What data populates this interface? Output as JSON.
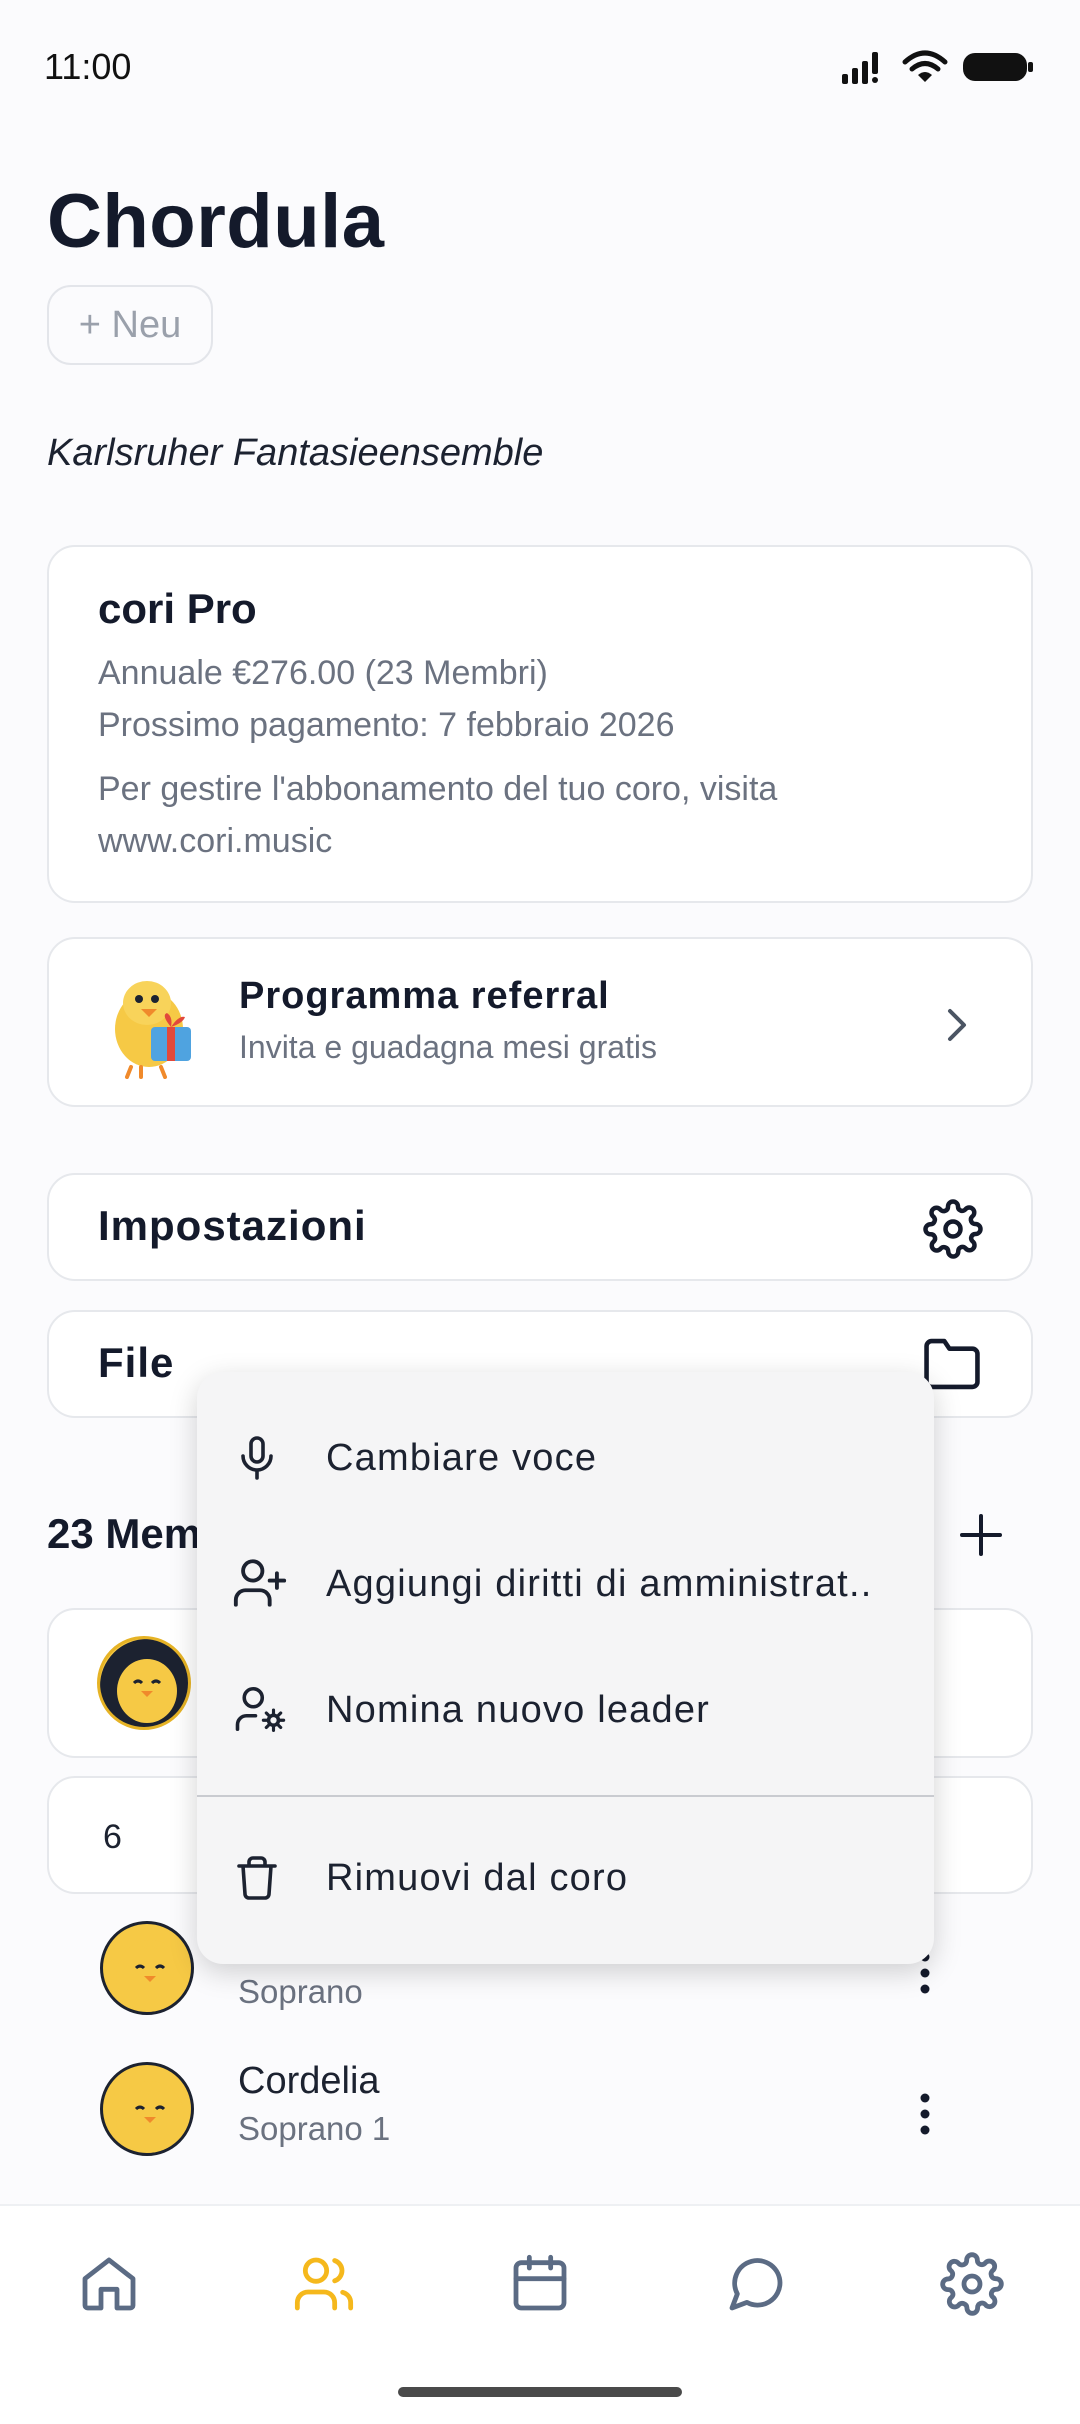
{
  "status_bar": {
    "time": "11:00"
  },
  "header": {
    "title": "Chordula",
    "new_button_label": "+ Neu"
  },
  "choir": {
    "name": "Karlsruher Fantasieensemble"
  },
  "subscription": {
    "plan": "cori Pro",
    "billing": "Annuale €276.00 (23 Membri)",
    "next_payment": "Prossimo pagamento: 7 febbraio 2026",
    "manage_line1": "Per gestire l'abbonamento del tuo coro, visita",
    "manage_line2": "www.cori.music"
  },
  "referral": {
    "title": "Programma referral",
    "subtitle": "Invita e guadagna mesi gratis"
  },
  "settings_row": {
    "label": "Impostazioni",
    "icon": "gear-icon"
  },
  "files_row": {
    "label": "File",
    "icon": "folder-icon"
  },
  "members": {
    "heading": "23 Mem",
    "group_count": "6",
    "items": [
      {
        "name": "",
        "voice": "Soprano"
      },
      {
        "name": "Cordelia",
        "voice": "Soprano 1"
      }
    ]
  },
  "context_menu": {
    "items": [
      {
        "label": "Cambiare voce",
        "icon": "microphone-icon"
      },
      {
        "label": "Aggiungi diritti di amministrat..",
        "icon": "user-plus-icon"
      },
      {
        "label": "Nomina nuovo leader",
        "icon": "user-cog-icon"
      },
      {
        "label": "Rimuovi dal coro",
        "icon": "trash-icon"
      }
    ]
  },
  "bottom_nav": {
    "items": [
      {
        "icon": "home-icon"
      },
      {
        "icon": "members-icon",
        "active": true
      },
      {
        "icon": "calendar-icon"
      },
      {
        "icon": "chat-icon"
      },
      {
        "icon": "settings-icon"
      }
    ],
    "active_color": "#f5b81c",
    "inactive_color": "#5b6b84"
  }
}
